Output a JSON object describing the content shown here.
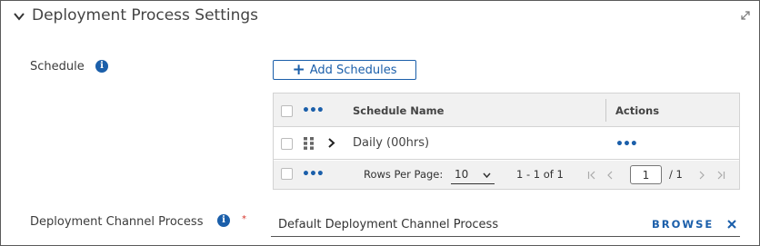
{
  "section": {
    "title": "Deployment Process Settings"
  },
  "schedule": {
    "label": "Schedule",
    "add_button_label": "Add Schedules",
    "table": {
      "columns": [
        "Schedule Name",
        "Actions"
      ],
      "rows": [
        {
          "name": "Daily (00hrs)",
          "actions": "•••"
        }
      ],
      "footer": {
        "rows_per_page_label": "Rows Per Page:",
        "rows_per_page_value": "10",
        "range_text": "1 - 1 of 1",
        "current_page": "1",
        "total_pages_text": "/ 1"
      },
      "menu_dots": "•••"
    }
  },
  "channel_process": {
    "label": "Deployment Channel Process",
    "required_mark": "*",
    "value": "Default Deployment Channel Process",
    "browse_label": "BROWSE"
  },
  "colors": {
    "accent": "#1b5faa",
    "required": "#d6342b",
    "header_bg": "#f1f1f1",
    "border": "#d3d3d3"
  }
}
